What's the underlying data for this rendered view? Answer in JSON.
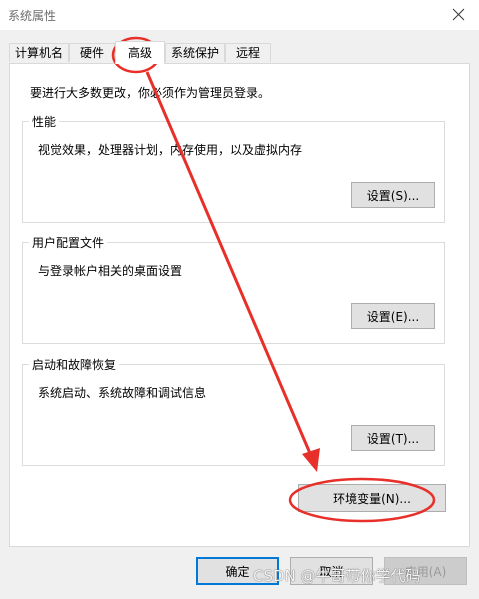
{
  "window": {
    "title": "系统属性"
  },
  "tabs": [
    {
      "label": "计算机名"
    },
    {
      "label": "硬件"
    },
    {
      "label": "高级"
    },
    {
      "label": "系统保护"
    },
    {
      "label": "远程"
    }
  ],
  "active_tab": "高级",
  "admin_note": "要进行大多数更改，你必须作为管理员登录。",
  "groups": {
    "performance": {
      "title": "性能",
      "description": "视觉效果，处理器计划，内存使用，以及虚拟内存",
      "button": "设置(S)..."
    },
    "user_profiles": {
      "title": "用户配置文件",
      "description": "与登录帐户相关的桌面设置",
      "button": "设置(E)..."
    },
    "startup_recovery": {
      "title": "启动和故障恢复",
      "description": "系统启动、系统故障和调试信息",
      "button": "设置(T)..."
    }
  },
  "env_button": "环境变量(N)...",
  "footer": {
    "ok": "确定",
    "cancel": "取消",
    "apply": "应用(A)"
  },
  "watermark": "CSDN @牛哥带你学代码",
  "annotation_color": "#e8302a"
}
